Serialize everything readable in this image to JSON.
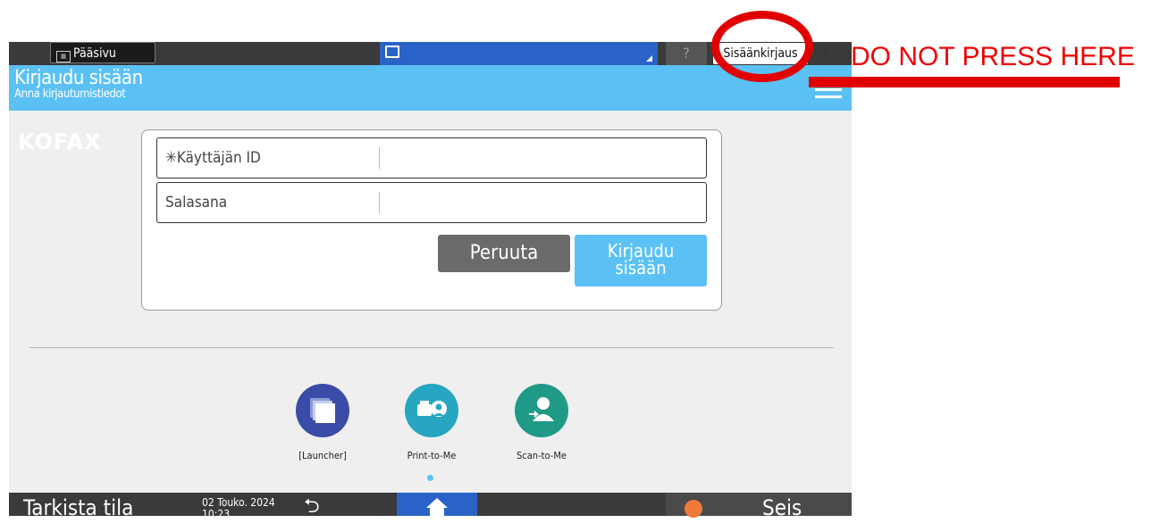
{
  "topbar": {
    "home_tab": "Pääsivu",
    "help": "?",
    "login": "Sisäänkirjaus"
  },
  "header": {
    "title": "Kirjaudu sisään",
    "subtitle": "Anna kirjautumistiedot"
  },
  "logo": "KOFAX",
  "form": {
    "user_id_label": "✳Käyttäjän ID",
    "user_id_value": "",
    "password_label": "Salasana",
    "password_value": "",
    "cancel_label": "Peruuta",
    "submit_label_line1": "Kirjaudu",
    "submit_label_line2": "sisään"
  },
  "apps": [
    {
      "label": "[Launcher]",
      "icon": "launcher-icon",
      "color": "#3a4ba8"
    },
    {
      "label": "Print-to-Me",
      "icon": "print-to-me-icon",
      "color": "#26a6c0"
    },
    {
      "label": "Scan-to-Me",
      "icon": "scan-to-me-icon",
      "color": "#1f9a86"
    }
  ],
  "bottombar": {
    "check_status": "Tarkista tila",
    "date": "02 Touko. 2024",
    "time": "10:23",
    "stop": "Seis"
  },
  "overlay": {
    "warning": "DO NOT PRESS HERE"
  },
  "colors": {
    "header": "#5bc1f4",
    "accent_blue": "#2a63c8",
    "warning_red": "#e00000"
  }
}
